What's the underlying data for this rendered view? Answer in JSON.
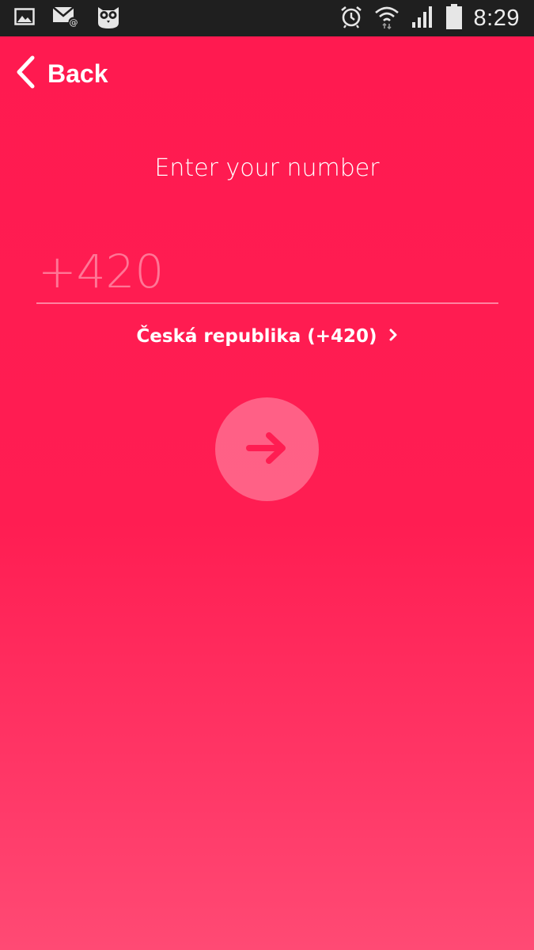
{
  "status_bar": {
    "time": "8:29",
    "left_icons": [
      "gallery-icon",
      "email-notification-icon",
      "owl-app-icon"
    ],
    "right_icons": [
      "alarm-icon",
      "wifi-icon",
      "signal-icon",
      "battery-icon"
    ]
  },
  "header": {
    "back_label": "Back"
  },
  "main": {
    "title": "Enter your number",
    "phone_placeholder": "+420",
    "phone_value": "",
    "country_label": "Česká republika (+420)"
  },
  "colors": {
    "background_top": "#ff1a50",
    "background_bottom": "#ff4a74",
    "status_bar": "#1f1f1f",
    "text": "#ffffff"
  }
}
